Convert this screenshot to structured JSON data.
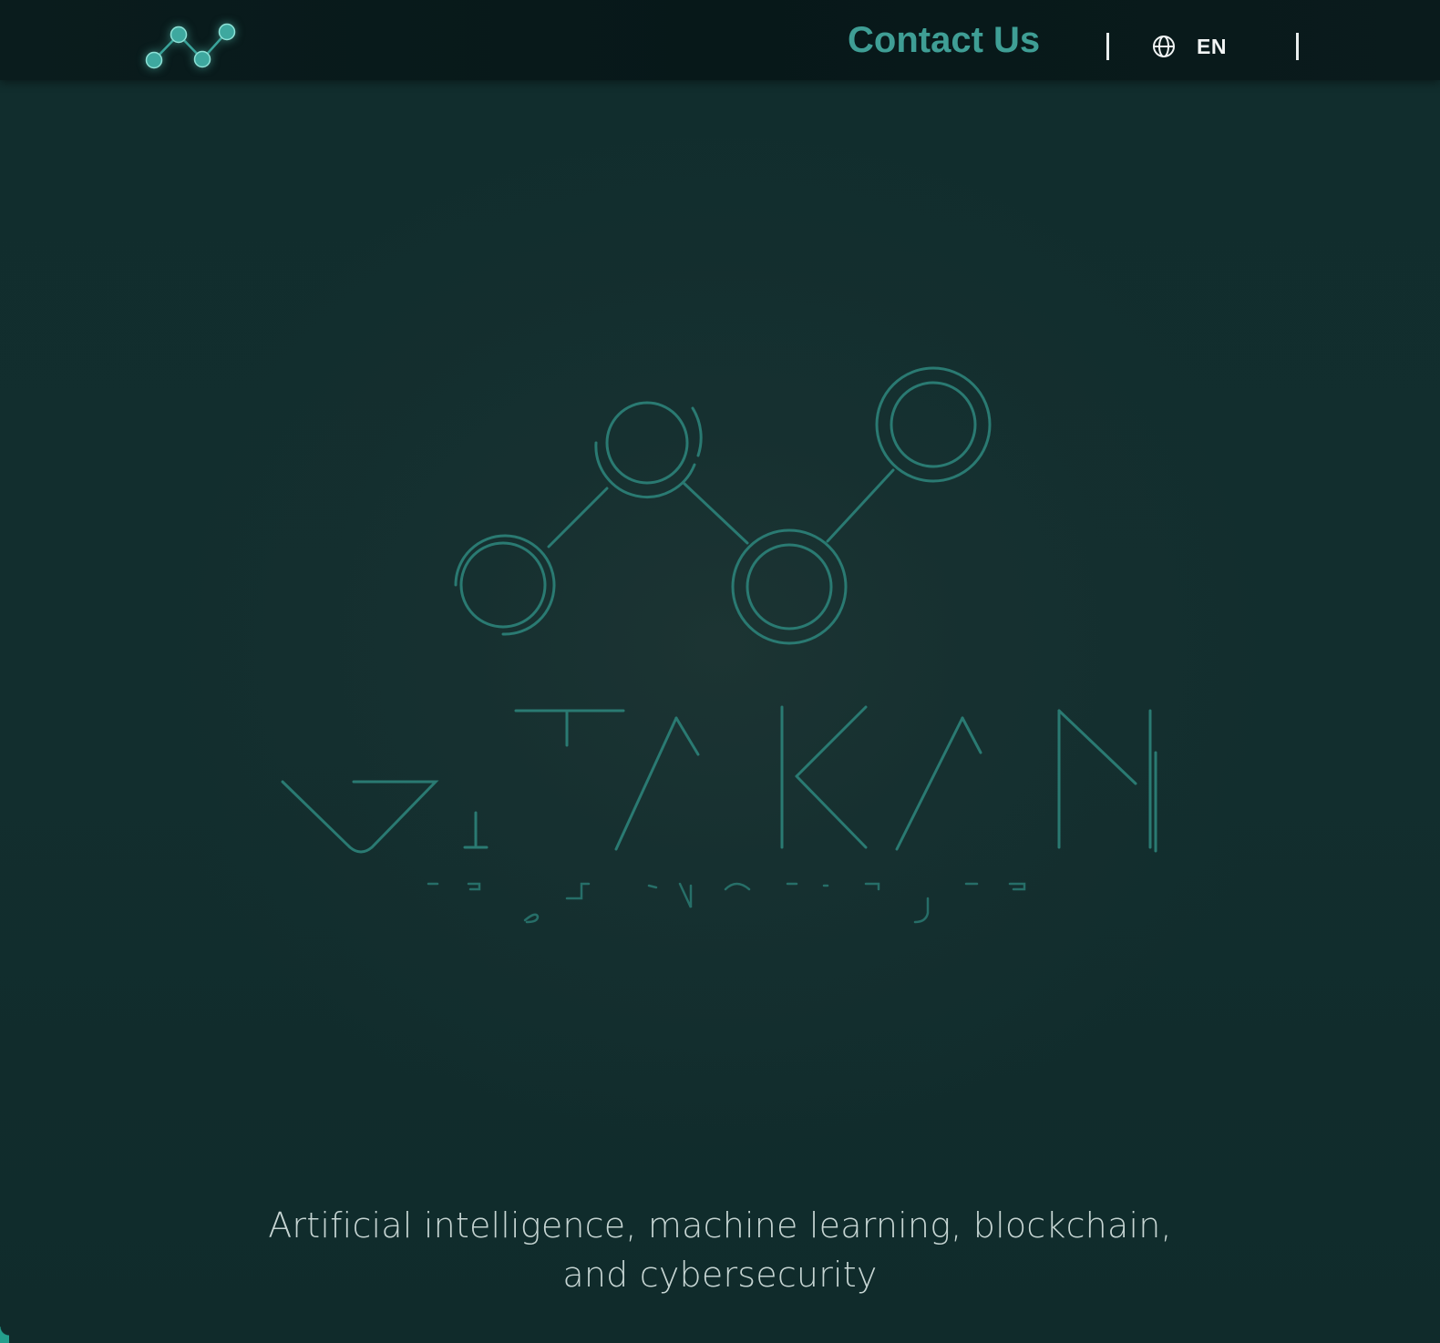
{
  "header": {
    "logo_icon": "network-nodes-logo-icon",
    "contact_label": "Contact Us",
    "language": {
      "icon": "globe-icon",
      "code": "EN"
    }
  },
  "hero": {
    "brand_logo": "network-nodes-wordmark-logo",
    "tagline_line1": "Artificial intelligence, machine learning, blockchain,",
    "tagline_line2": "and cybersecurity"
  },
  "colors": {
    "accent": "#3f9e95",
    "logo_stroke": "#2a7a72",
    "header_bg": "#071819",
    "hero_bg": "#122e2e",
    "text_light": "#c6d5d3"
  }
}
